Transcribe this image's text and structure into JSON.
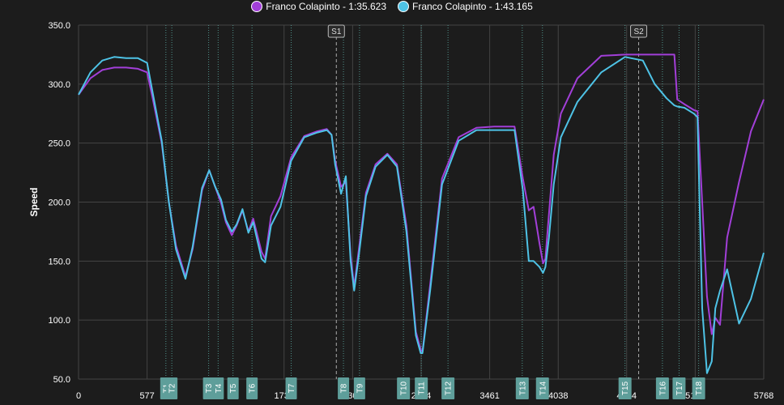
{
  "legend": {
    "items": [
      {
        "label": "Franco Colapinto - 1:35.623",
        "color": "#a23fd8"
      },
      {
        "label": "Franco Colapinto - 1:43.165",
        "color": "#4ec3e6"
      }
    ]
  },
  "chart_data": {
    "type": "line",
    "title": "",
    "xlabel": "",
    "ylabel": "Speed",
    "xlim": [
      0,
      5768
    ],
    "ylim": [
      50,
      350
    ],
    "grid": true,
    "legend_position": "top-center",
    "y_ticks": [
      "350.0",
      "300.0",
      "250.0",
      "200.0",
      "150.0",
      "100.0",
      "50.0"
    ],
    "y_tick_values": [
      350,
      300,
      250,
      200,
      150,
      100,
      50
    ],
    "x_ticks": [
      {
        "value": 0,
        "label": "0"
      },
      {
        "value": 577,
        "label": "577"
      },
      {
        "value": 1730,
        "label": "1730"
      },
      {
        "value": 2307,
        "label": "2307"
      },
      {
        "value": 2884,
        "label": "2884"
      },
      {
        "value": 3461,
        "label": "3461"
      },
      {
        "value": 4038,
        "label": "4038"
      },
      {
        "value": 4614,
        "label": "4614"
      },
      {
        "value": 5191,
        "label": "5191"
      },
      {
        "value": 5768,
        "label": "5768"
      }
    ],
    "sectors": [
      {
        "label": "S1",
        "x": 2170
      },
      {
        "label": "S2",
        "x": 4715
      }
    ],
    "corners": [
      {
        "label": "T1",
        "x": 735
      },
      {
        "label": "T2",
        "x": 785
      },
      {
        "label": "T3",
        "x": 1095
      },
      {
        "label": "T4",
        "x": 1175
      },
      {
        "label": "T5",
        "x": 1300
      },
      {
        "label": "T6",
        "x": 1460
      },
      {
        "label": "T7",
        "x": 1790
      },
      {
        "label": "T8",
        "x": 2230
      },
      {
        "label": "T9",
        "x": 2365
      },
      {
        "label": "T10",
        "x": 2735
      },
      {
        "label": "T11",
        "x": 2885
      },
      {
        "label": "T12",
        "x": 3110
      },
      {
        "label": "T13",
        "x": 3735
      },
      {
        "label": "T14",
        "x": 3905
      },
      {
        "label": "T15",
        "x": 4600
      },
      {
        "label": "T16",
        "x": 4915
      },
      {
        "label": "T17",
        "x": 5055
      },
      {
        "label": "T18",
        "x": 5220
      }
    ],
    "series": [
      {
        "name": "Franco Colapinto - 1:35.623",
        "color": "#a23fd8",
        "x": [
          0,
          100,
          200,
          300,
          400,
          500,
          577,
          620,
          700,
          760,
          820,
          900,
          960,
          1040,
          1100,
          1150,
          1200,
          1240,
          1290,
          1330,
          1380,
          1430,
          1470,
          1540,
          1570,
          1620,
          1700,
          1790,
          1900,
          2010,
          2090,
          2130,
          2160,
          2210,
          2250,
          2290,
          2320,
          2360,
          2420,
          2500,
          2600,
          2680,
          2760,
          2840,
          2880,
          2895,
          2960,
          3060,
          3200,
          3350,
          3500,
          3600,
          3670,
          3740,
          3790,
          3830,
          3880,
          3910,
          3930,
          3960,
          4000,
          4060,
          4200,
          4400,
          4600,
          4750,
          4850,
          4950,
          5015,
          5040,
          5100,
          5180,
          5210,
          5250,
          5290,
          5330,
          5360,
          5400,
          5460,
          5560,
          5660,
          5768
        ],
        "y": [
          291,
          305,
          312,
          314,
          314,
          313,
          310,
          290,
          250,
          200,
          163,
          137,
          160,
          210,
          227,
          213,
          199,
          183,
          172,
          180,
          193,
          175,
          186,
          158,
          152,
          188,
          205,
          238,
          256,
          260,
          262,
          257,
          235,
          213,
          217,
          155,
          128,
          160,
          208,
          232,
          241,
          232,
          180,
          90,
          75,
          73,
          130,
          220,
          255,
          263,
          264,
          264,
          264,
          220,
          193,
          196,
          165,
          148,
          152,
          190,
          240,
          275,
          305,
          324,
          325,
          325,
          325,
          325,
          325,
          287,
          283,
          278,
          277,
          200,
          120,
          88,
          102,
          96,
          170,
          217,
          260,
          287
        ]
      },
      {
        "name": "Franco Colapinto - 1:43.165",
        "color": "#4ec3e6",
        "x": [
          0,
          100,
          200,
          300,
          400,
          500,
          577,
          620,
          700,
          760,
          820,
          900,
          960,
          1040,
          1100,
          1150,
          1200,
          1240,
          1290,
          1330,
          1380,
          1430,
          1470,
          1540,
          1570,
          1620,
          1700,
          1790,
          1900,
          2010,
          2090,
          2130,
          2160,
          2210,
          2250,
          2290,
          2320,
          2360,
          2420,
          2500,
          2600,
          2680,
          2760,
          2840,
          2880,
          2895,
          2960,
          3060,
          3200,
          3350,
          3500,
          3600,
          3670,
          3740,
          3790,
          3830,
          3880,
          3910,
          3930,
          3960,
          4000,
          4060,
          4200,
          4400,
          4600,
          4750,
          4850,
          4950,
          5015,
          5040,
          5100,
          5180,
          5210,
          5250,
          5290,
          5330,
          5360,
          5400,
          5460,
          5560,
          5660,
          5768
        ],
        "y": [
          291,
          310,
          320,
          323,
          322,
          322,
          318,
          295,
          252,
          200,
          160,
          135,
          162,
          212,
          227,
          213,
          202,
          185,
          175,
          181,
          194,
          174,
          183,
          152,
          149,
          180,
          196,
          235,
          255,
          259,
          261,
          257,
          232,
          207,
          222,
          150,
          125,
          155,
          205,
          230,
          240,
          230,
          175,
          87,
          72,
          72,
          125,
          215,
          252,
          261,
          261,
          261,
          261,
          210,
          150,
          150,
          145,
          140,
          145,
          170,
          215,
          255,
          285,
          310,
          323,
          320,
          300,
          288,
          282,
          281,
          280,
          275,
          272,
          110,
          55,
          65,
          110,
          125,
          143,
          97,
          118,
          157
        ]
      }
    ]
  }
}
